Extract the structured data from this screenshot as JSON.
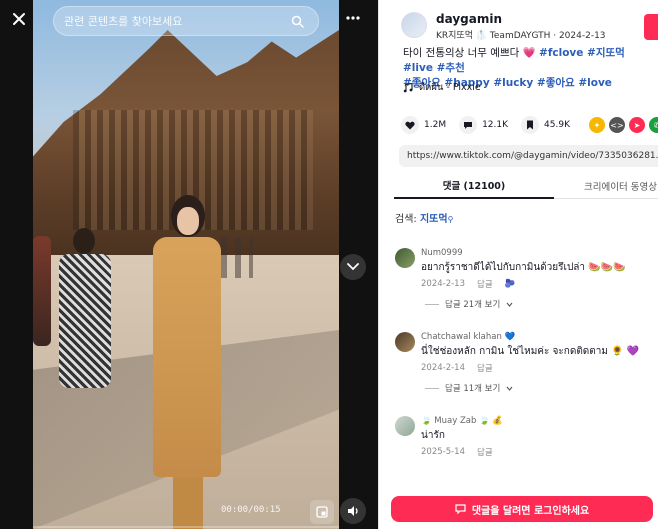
{
  "video": {
    "search_placeholder": "관련 콘텐츠를 찾아보세요",
    "time_readout": "00:00/00:15",
    "progress": 0.0
  },
  "icons": {
    "close": "close-icon",
    "search": "search-icon",
    "more": "more-icon",
    "next": "chevron-down-icon",
    "pip": "picture-in-picture-icon",
    "volume": "volume-icon",
    "like": "heart-icon",
    "comment": "comment-icon",
    "save": "bookmark-icon",
    "music": "music-note-icon"
  },
  "post": {
    "username": "daygamin",
    "sub_meta": "KR지또먹 🥼 TeamDAYGTH · 2024-2-13",
    "caption_text": "타이 전통의상 너무 예쁘다 💗 ",
    "hashtags_line1": "#fclove #지또먹 #live #추천",
    "hashtags_line2": "#좋아요 #happy #lucky #좋아요 #love",
    "music": "ดีดผิน - Pixxie",
    "likes": "1.2M",
    "comments": "12.1K",
    "saves": "45.9K",
    "url": "https://www.tiktok.com/@daygamin/video/7335036281..."
  },
  "tabs": {
    "comments": "댓글 (12100)",
    "creator_videos": "크리에이터 동영상"
  },
  "search": {
    "label": "검색:",
    "keyword": "지또먹"
  },
  "comments": [
    {
      "name": "Num0999",
      "text": "อยากรู้ราชาดีได้ไปกับกามินด้วยรึเปล่า 🍉🍉🍉",
      "date": "2024-2-13",
      "reply": "답글",
      "replies": "답글 21개 보기"
    },
    {
      "name": "Chatchawal klahan 💙",
      "text": "นี่ใช่ช่องหลัก กามิน ใช่ไหมค่ะ จะกดติดตาม 🌻 💜",
      "date": "2024-2-14",
      "reply": "답글",
      "replies": "답글 11개 보기"
    },
    {
      "name": "🍃 Muay Zab 🍃 💰",
      "text": "น่ารัก",
      "date": "2025-5-14",
      "reply": "답글"
    }
  ],
  "login_button": "댓글을 달려면 로그인하세요",
  "colors": {
    "accent": "#fe2c55",
    "hashtag": "#2b5db9",
    "text": "#161823"
  }
}
